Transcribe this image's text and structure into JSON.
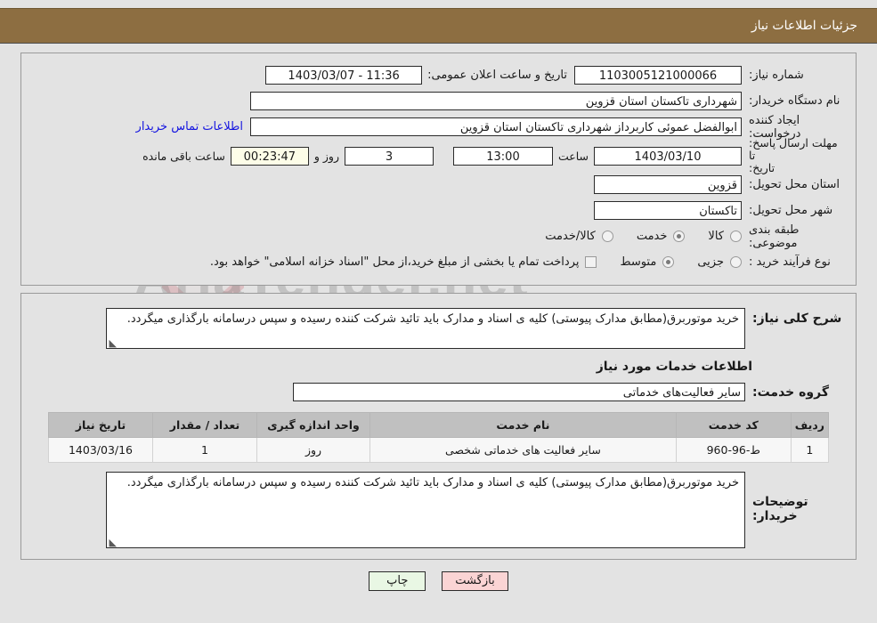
{
  "header": {
    "title": "جزئیات اطلاعات نیاز"
  },
  "form": {
    "need_number_label": "شماره نیاز:",
    "need_number_value": "1103005121000066",
    "public_announce_label": "تاریخ و ساعت اعلان عمومی:",
    "public_announce_value": "11:36 - 1403/03/07",
    "buyer_org_label": "نام دستگاه خریدار:",
    "buyer_org_value": "شهرداری تاکستان استان قزوین",
    "requester_label": "ایجاد کننده درخواست:",
    "requester_value": "ابوالفضل عموئی کاربرداز شهرداری تاکستان استان قزوین",
    "contact_link": "اطلاعات تماس خریدار",
    "deadline_label_line1": "مهلت ارسال پاسخ: تا",
    "deadline_label_line2": "تاریخ:",
    "deadline_date": "1403/03/10",
    "hour_label": "ساعت",
    "deadline_time": "13:00",
    "days_value": "3",
    "days_label": "روز و",
    "countdown_value": "00:23:47",
    "countdown_label": "ساعت باقی مانده",
    "province_label": "استان محل تحویل:",
    "province_value": "قزوین",
    "city_label": "شهر محل تحویل:",
    "city_value": "تاکستان",
    "category_label": "طبقه بندی موضوعی:",
    "category_options": [
      {
        "label": "کالا",
        "selected": false
      },
      {
        "label": "خدمت",
        "selected": true
      },
      {
        "label": "کالا/خدمت",
        "selected": false
      }
    ],
    "process_label": "نوع فرآیند خرید :",
    "process_options": [
      {
        "label": "جزیی",
        "selected": false
      },
      {
        "label": "متوسط",
        "selected": true
      }
    ],
    "treasury_checkbox_checked": false,
    "treasury_note": "پرداخت تمام یا بخشی از مبلغ خرید،از محل \"اسناد خزانه اسلامی\" خواهد بود."
  },
  "details": {
    "need_desc_label": "شرح کلی نیاز:",
    "need_desc_value": "خرید موتوربرق(مطابق مدارک پیوستی) کلیه ی اسناد و مدارک باید تائید شرکت کننده رسیده و سپس درسامانه بارگذاری میگردد.",
    "services_section_title": "اطلاعات خدمات مورد نیاز",
    "service_group_label": "گروه خدمت:",
    "service_group_value": "سایر فعالیت‌های خدماتی",
    "buyer_notes_label": "توضیحات خریدار:",
    "buyer_notes_value": "خرید موتوربرق(مطابق مدارک پیوستی) کلیه ی اسناد و مدارک باید تائید شرکت کننده رسیده و سپس درسامانه بارگذاری میگردد."
  },
  "table": {
    "columns": [
      "ردیف",
      "کد خدمت",
      "نام خدمت",
      "واحد اندازه گیری",
      "تعداد / مقدار",
      "تاریخ نیاز"
    ],
    "rows": [
      {
        "radif": "1",
        "code": "ط-96-960",
        "name": "سایر فعالیت های خدماتی شخصی",
        "unit": "روز",
        "qty": "1",
        "date": "1403/03/16"
      }
    ]
  },
  "footer": {
    "print_label": "چاپ",
    "back_label": "بازگشت"
  },
  "watermark": {
    "brand": "AriaTender.net"
  },
  "colors": {
    "header_bg": "#8d6e41",
    "page_bg": "#e3e3e3",
    "link": "#1515e0",
    "countdown_bg": "#fdfde8",
    "print_btn_bg": "#e9f7e4",
    "back_btn_bg": "#fbd4d4",
    "table_header_bg": "#c0c0c0"
  }
}
